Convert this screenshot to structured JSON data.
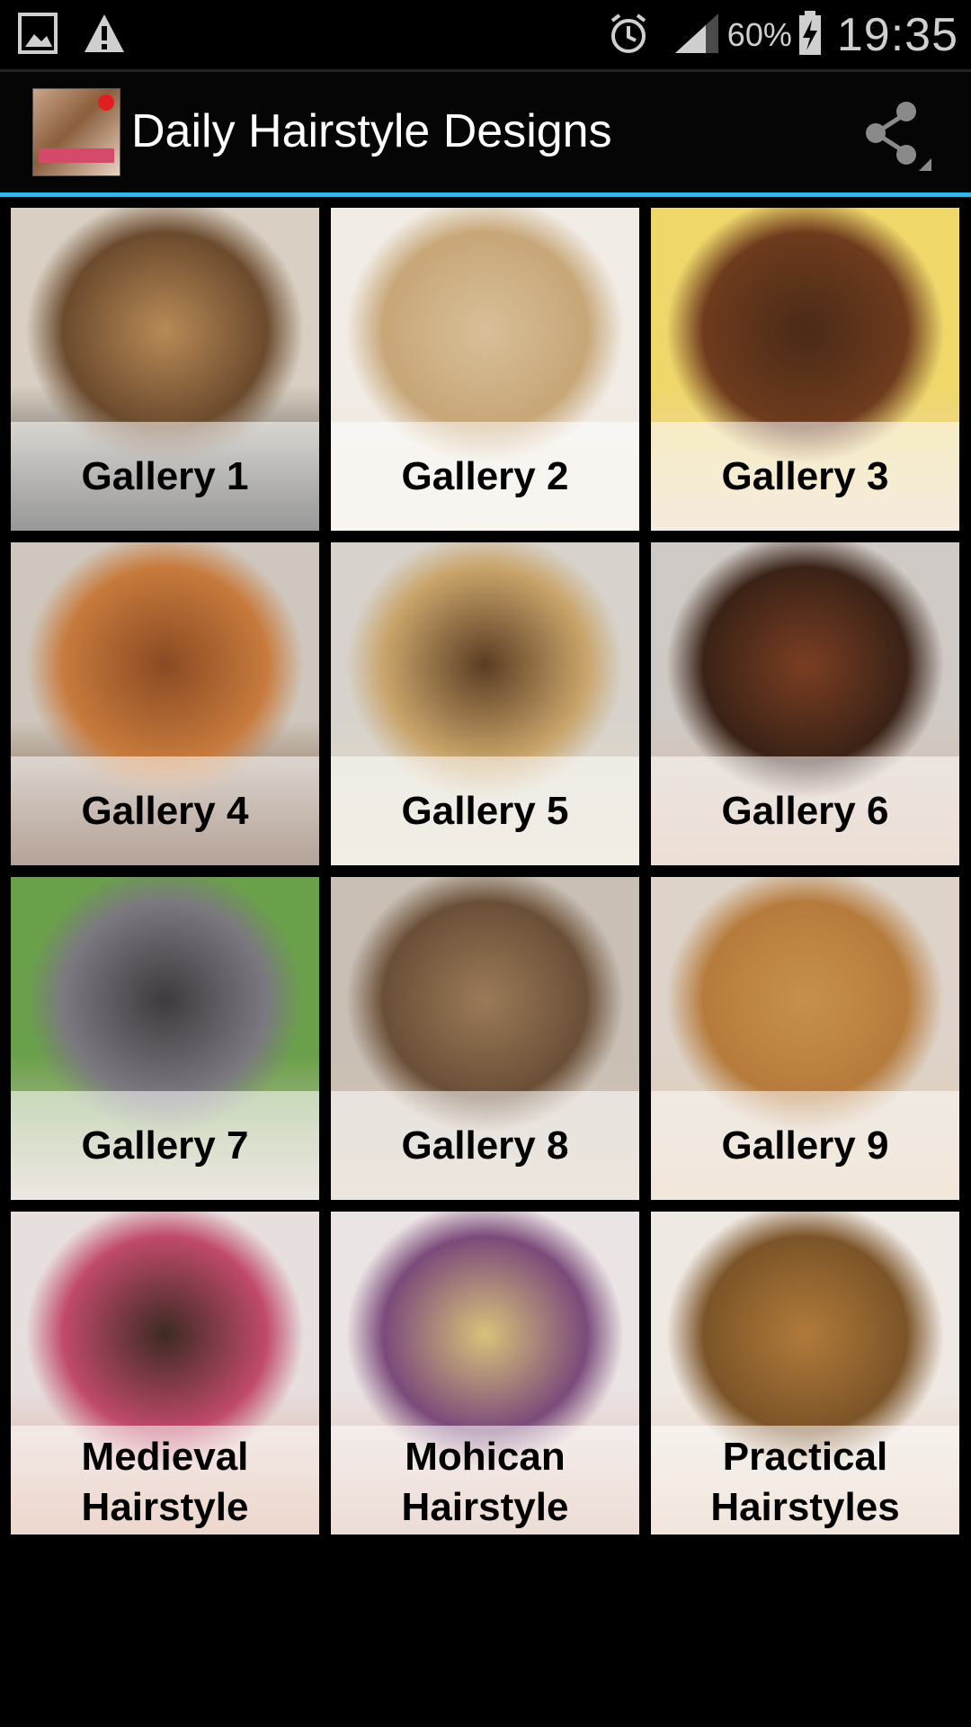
{
  "status_bar": {
    "left_icons": [
      "image-icon",
      "warning-icon"
    ],
    "right_icons": [
      "alarm-icon",
      "signal-icon",
      "battery-charging-icon"
    ],
    "battery_percent": "60%",
    "time": "19:35"
  },
  "action_bar": {
    "title": "Daily Hairstyle Designs",
    "share_icon": "share-icon",
    "accent_color": "#33b5e5"
  },
  "galleries": [
    {
      "label": "Gallery 1",
      "colors": [
        "#d9cfc2",
        "#b98a56",
        "#6b4a2d",
        "#1b1b1b"
      ]
    },
    {
      "label": "Gallery 2",
      "colors": [
        "#f1ece6",
        "#d8bf98",
        "#c7a677",
        "#efe6da"
      ]
    },
    {
      "label": "Gallery 3",
      "colors": [
        "#efd76a",
        "#4a2a17",
        "#6e3b1d",
        "#e9d2b7"
      ]
    },
    {
      "label": "Gallery 4",
      "colors": [
        "#cfc7bd",
        "#8a4a22",
        "#c77a3c",
        "#5a3218"
      ]
    },
    {
      "label": "Gallery 5",
      "colors": [
        "#d7d3cc",
        "#5a3c22",
        "#c9a46a",
        "#e5d9c2"
      ]
    },
    {
      "label": "Gallery 6",
      "colors": [
        "#cfcac5",
        "#7a3e22",
        "#3a2216",
        "#d9b8a2"
      ]
    },
    {
      "label": "Gallery 7",
      "colors": [
        "#6aa04a",
        "#3f3a3f",
        "#7c7880",
        "#d9c9bf"
      ]
    },
    {
      "label": "Gallery 8",
      "colors": [
        "#c9bfb4",
        "#9b7a58",
        "#6a4f37",
        "#d6c7b6"
      ]
    },
    {
      "label": "Gallery 9",
      "colors": [
        "#ddd3c8",
        "#c7904e",
        "#b67b3c",
        "#e0c9ae"
      ]
    },
    {
      "label": "Medieval\nHairstyle",
      "colors": [
        "#e7dede",
        "#3d2a22",
        "#c04a6a",
        "#d8a58f"
      ]
    },
    {
      "label": "Mohican\nHairstyle",
      "colors": [
        "#ebe4e4",
        "#d8c27a",
        "#7b4a7a",
        "#d7b2a3"
      ]
    },
    {
      "label": "Practical\nHairstyles",
      "colors": [
        "#efe9e4",
        "#b07a3a",
        "#7c5428",
        "#e0c7b2"
      ]
    }
  ]
}
